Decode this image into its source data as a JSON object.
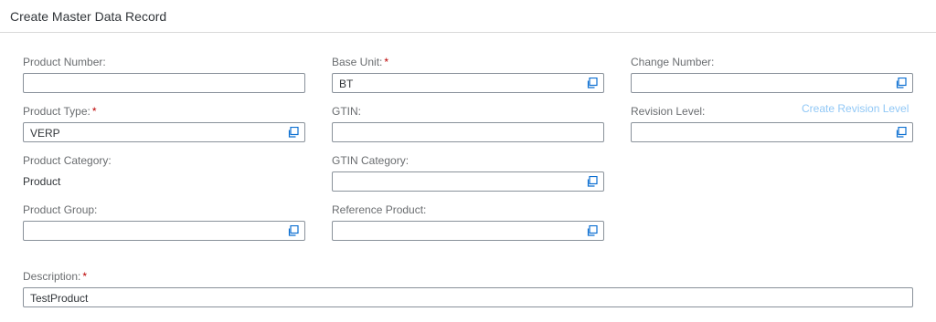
{
  "dialog": {
    "title": "Create Master Data Record"
  },
  "form": {
    "product_number": {
      "label": "Product Number:",
      "value": ""
    },
    "base_unit": {
      "label": "Base Unit:",
      "required": "*",
      "value": "BT"
    },
    "change_number": {
      "label": "Change Number:",
      "value": ""
    },
    "product_type": {
      "label": "Product Type:",
      "required": "*",
      "value": "VERP"
    },
    "gtin": {
      "label": "GTIN:",
      "value": ""
    },
    "revision_level": {
      "label": "Revision Level:",
      "value": "",
      "link": "Create Revision Level"
    },
    "product_category": {
      "label": "Product Category:",
      "value": "Product"
    },
    "gtin_category": {
      "label": "GTIN Category:",
      "value": ""
    },
    "product_group": {
      "label": "Product Group:",
      "value": ""
    },
    "reference_product": {
      "label": "Reference Product:",
      "value": ""
    },
    "description": {
      "label": "Description:",
      "required": "*",
      "value": "TestProduct"
    }
  },
  "colors": {
    "required": "#bb0000",
    "link": "#91c8f6",
    "border": "#89919a",
    "label": "#6a6d70",
    "value_help_icon": "#0a6ed1"
  },
  "icons": {
    "value_help": "value-help-icon"
  }
}
